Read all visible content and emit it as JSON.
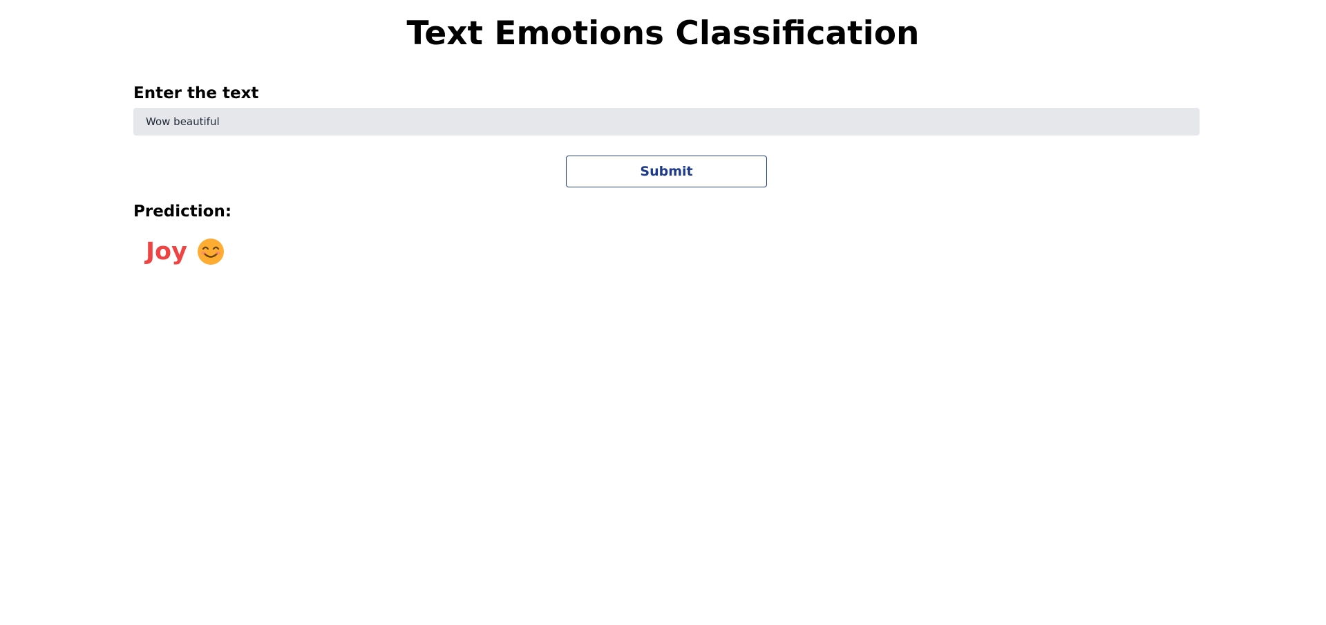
{
  "header": {
    "title": "Text Emotions Classification"
  },
  "form": {
    "input_label": "Enter the text",
    "input_value": "Wow beautiful",
    "submit_label": "Submit"
  },
  "prediction": {
    "label": "Prediction:",
    "emotion": "Joy",
    "emotion_color": "#ef4444",
    "icon": "smiling-face-icon"
  },
  "colors": {
    "input_background": "#e5e7eb",
    "button_accent": "#1e3a8a",
    "emoji_face": "#ffac33"
  }
}
